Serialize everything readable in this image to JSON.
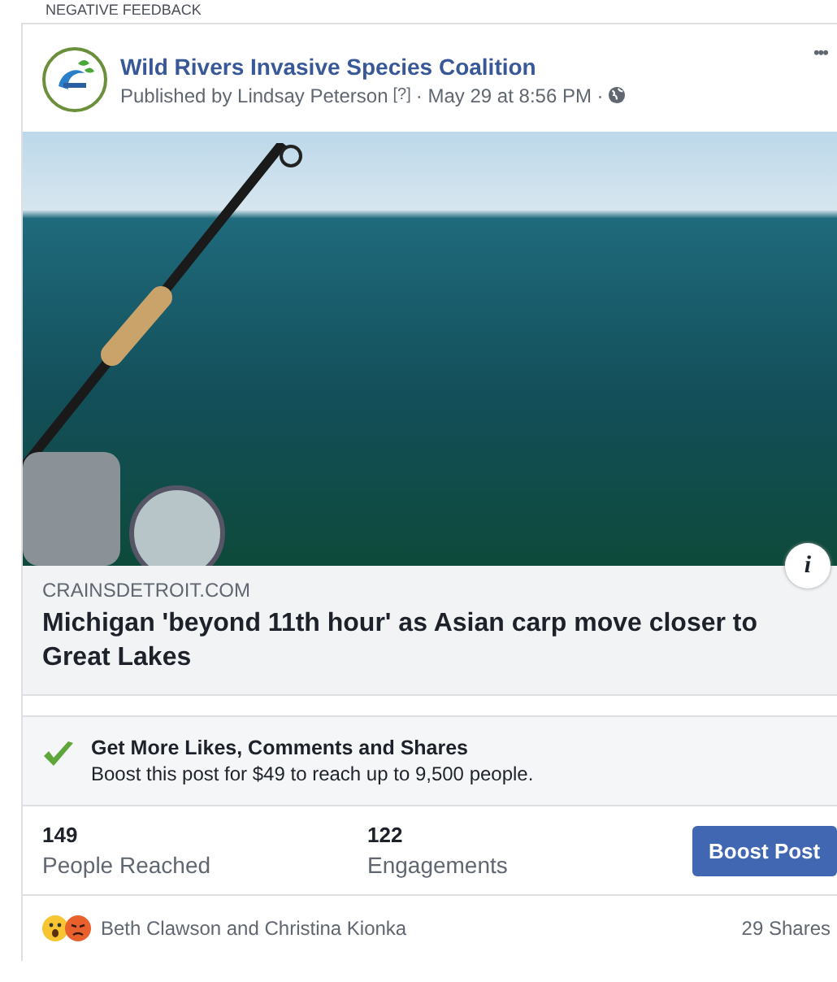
{
  "section_label": "NEGATIVE FEEDBACK",
  "post": {
    "page_name": "Wild Rivers Invasive Species Coalition",
    "published_by": "Published by Lindsay Peterson",
    "help_mark": "[?]",
    "time": "· May 29 at 8:56 PM ·",
    "menu": "•••"
  },
  "link": {
    "domain": "CRAINSDETROIT.COM",
    "title": "Michigan 'beyond 11th hour' as Asian carp move closer to Great Lakes",
    "info": "i"
  },
  "boost_tip": {
    "title": "Get More Likes, Comments and Shares",
    "text": "Boost this post for $49 to reach up to 9,500 people."
  },
  "stats": [
    {
      "value": "149",
      "label": "People Reached"
    },
    {
      "value": "122",
      "label": "Engagements"
    }
  ],
  "boost_button": "Boost Post",
  "reactions": {
    "names": "Beth Clawson and Christina Kionka",
    "shares": "29 Shares"
  }
}
